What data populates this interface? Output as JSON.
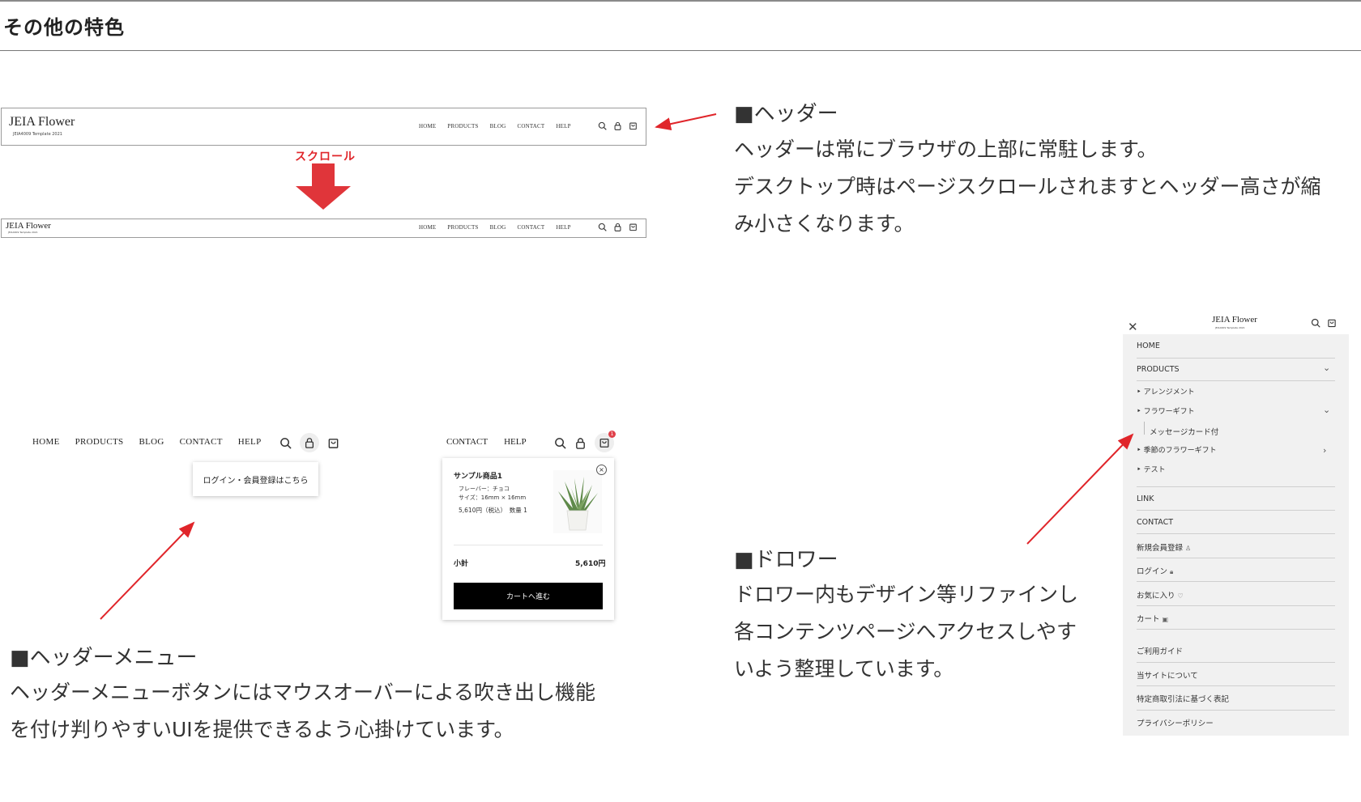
{
  "page_title": "その他の特色",
  "header_mock": {
    "logo": "JEIA Flower",
    "logo_sub": "JEIA4009 Template 2021",
    "nav": [
      "HOME",
      "PRODUCTS",
      "BLOG",
      "CONTACT",
      "HELP"
    ],
    "icons": [
      "search-icon",
      "lock-icon",
      "cart-icon"
    ]
  },
  "scroll_label": "スクロール",
  "header_section": {
    "heading": "■ヘッダー",
    "lines": [
      "ヘッダーは常にブラウザの上部に常駐します。",
      "デスクトップ時はページスクロールされますとヘッダー高さが縮",
      "み小さくなります。"
    ]
  },
  "menu_demo": {
    "nav": [
      "HOME",
      "PRODUCTS",
      "BLOG",
      "CONTACT",
      "HELP"
    ],
    "tooltip": "ログイン・会員登録はこちら"
  },
  "cart_demo": {
    "nav": [
      "CONTACT",
      "HELP"
    ],
    "badge": "1",
    "product_name": "サンプル商品1",
    "flavor": "フレーバー：チョコ",
    "size": "サイズ：16mm × 16mm",
    "price": "5,610円（税込）　数量 1",
    "close": "×",
    "subtotal_label": "小計",
    "subtotal_value": "5,610円",
    "button": "カートへ進む"
  },
  "menu_section": {
    "heading": "■ヘッダーメニュー",
    "lines": [
      "ヘッダーメニューボタンにはマウスオーバーによる吹き出し機能",
      "を付け判りやすいUIを提供できるよう心掛けています。"
    ]
  },
  "drawer_section": {
    "heading": "■ドロワー",
    "lines": [
      "ドロワー内もデザイン等リファインし",
      "各コンテンツページへアクセスしやす",
      "いよう整理しています。"
    ]
  },
  "drawer": {
    "close": "✕",
    "logo": "JEIA Flower",
    "logo_sub": "JEIA4009 Template 2021",
    "items": {
      "home": "HOME",
      "products": "PRODUCTS",
      "arrange": "アレンジメント",
      "flower_gift": "フラワーギフト",
      "message_card": "メッセージカード付",
      "season_gift": "季節のフラワーギフト",
      "test": "テスト",
      "link": "LINK",
      "contact": "CONTACT",
      "register": "新規会員登録",
      "login": "ログイン",
      "favorite": "お気に入り",
      "cart": "カート",
      "guide": "ご利用ガイド",
      "about": "当サイトについて",
      "law": "特定商取引法に基づく表記",
      "privacy": "プライバシーポリシー"
    }
  },
  "colors": {
    "accent_red": "#e0252a",
    "text": "#333333",
    "button_bg": "#000000"
  }
}
